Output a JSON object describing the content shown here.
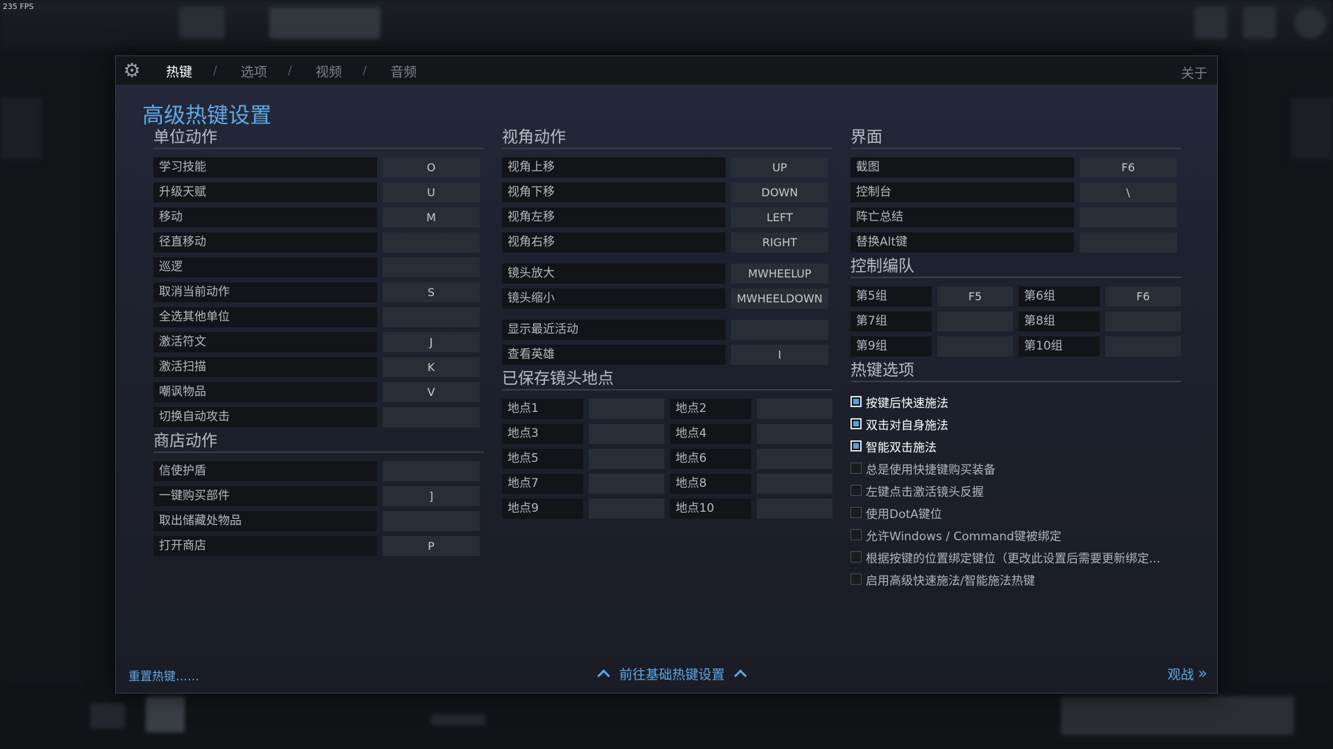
{
  "fps": "235 FPS",
  "tabs": [
    "热键",
    "选项",
    "视频",
    "音频"
  ],
  "about": "关于",
  "title": "高级热键设置",
  "unit_actions": {
    "heading": "单位动作",
    "rows": [
      {
        "label": "学习技能",
        "key": "O"
      },
      {
        "label": "升级天赋",
        "key": "U"
      },
      {
        "label": "移动",
        "key": "M"
      },
      {
        "label": "径直移动",
        "key": ""
      },
      {
        "label": "巡逻",
        "key": ""
      },
      {
        "label": "取消当前动作",
        "key": "S"
      },
      {
        "label": "全选其他单位",
        "key": ""
      },
      {
        "label": "激活符文",
        "key": "J"
      },
      {
        "label": "激活扫描",
        "key": "K"
      },
      {
        "label": "嘲讽物品",
        "key": "V"
      },
      {
        "label": "切换自动攻击",
        "key": ""
      }
    ]
  },
  "shop_actions": {
    "heading": "商店动作",
    "rows": [
      {
        "label": "信使护盾",
        "key": ""
      },
      {
        "label": "一键购买部件",
        "key": "]"
      },
      {
        "label": "取出储藏处物品",
        "key": ""
      },
      {
        "label": "打开商店",
        "key": "P"
      }
    ]
  },
  "camera_actions": {
    "heading": "视角动作",
    "group1": [
      {
        "label": "视角上移",
        "key": "UP"
      },
      {
        "label": "视角下移",
        "key": "DOWN"
      },
      {
        "label": "视角左移",
        "key": "LEFT"
      },
      {
        "label": "视角右移",
        "key": "RIGHT"
      }
    ],
    "group2": [
      {
        "label": "镜头放大",
        "key": "MWHEELUP"
      },
      {
        "label": "镜头缩小",
        "key": "MWHEELDOWN"
      }
    ],
    "group3": [
      {
        "label": "显示最近活动",
        "key": ""
      },
      {
        "label": "查看英雄",
        "key": "I"
      }
    ]
  },
  "saved_camera": {
    "heading": "已保存镜头地点",
    "rows": [
      [
        {
          "label": "地点1",
          "key": ""
        },
        {
          "label": "地点2",
          "key": ""
        }
      ],
      [
        {
          "label": "地点3",
          "key": ""
        },
        {
          "label": "地点4",
          "key": ""
        }
      ],
      [
        {
          "label": "地点5",
          "key": ""
        },
        {
          "label": "地点6",
          "key": ""
        }
      ],
      [
        {
          "label": "地点7",
          "key": ""
        },
        {
          "label": "地点8",
          "key": ""
        }
      ],
      [
        {
          "label": "地点9",
          "key": ""
        },
        {
          "label": "地点10",
          "key": ""
        }
      ]
    ]
  },
  "interface": {
    "heading": "界面",
    "rows": [
      {
        "label": "截图",
        "key": "F6"
      },
      {
        "label": "控制台",
        "key": "\\"
      },
      {
        "label": "阵亡总结",
        "key": ""
      },
      {
        "label": "替换Alt键",
        "key": ""
      }
    ]
  },
  "control_groups": {
    "heading": "控制编队",
    "rows": [
      [
        {
          "label": "第5组",
          "key": "F5"
        },
        {
          "label": "第6组",
          "key": "F6"
        }
      ],
      [
        {
          "label": "第7组",
          "key": ""
        },
        {
          "label": "第8组",
          "key": ""
        }
      ],
      [
        {
          "label": "第9组",
          "key": ""
        },
        {
          "label": "第10组",
          "key": ""
        }
      ]
    ]
  },
  "hotkey_options": {
    "heading": "热键选项",
    "items": [
      {
        "label": "按键后快速施法",
        "checked": true
      },
      {
        "label": "双击对自身施法",
        "checked": true
      },
      {
        "label": "智能双击施法",
        "checked": true
      },
      {
        "label": "总是使用快捷键购买装备",
        "checked": false
      },
      {
        "label": "左键点击激活镜头反握",
        "checked": false
      },
      {
        "label": "使用DotA键位",
        "checked": false
      },
      {
        "label": "允许Windows / Command键被绑定",
        "checked": false
      },
      {
        "label": "根据按键的位置绑定键位（更改此设置后需要更新绑定...",
        "checked": false
      },
      {
        "label": "启用高级快速施法/智能施法热键",
        "checked": false
      }
    ]
  },
  "footer": {
    "reset": "重置热键……",
    "basic": "前往基础热键设置",
    "spectate": "观战"
  },
  "colors": {
    "accent": "#5fa8e6",
    "panel": "#1e2230",
    "key_bg": "#292d35",
    "label_bg": "#121418"
  }
}
